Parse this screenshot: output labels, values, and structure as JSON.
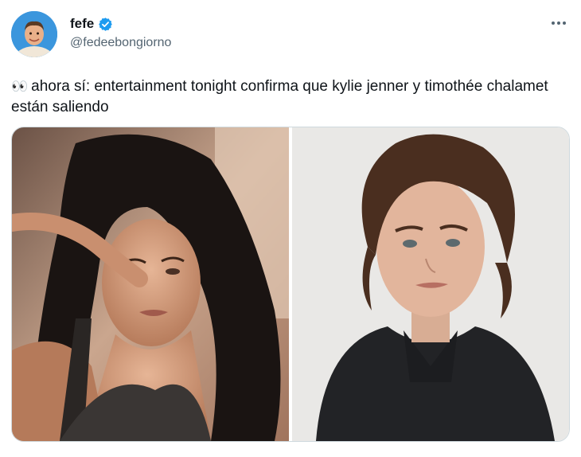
{
  "tweet": {
    "display_name": "fefe",
    "handle": "@fedeebongiorno",
    "verified": true,
    "eyes_emoji": "👀",
    "text": "ahora sí: entertainment tonight confirma que kylie jenner y timothée chalamet están saliendo",
    "more_icon": "more-horizontal-icon"
  },
  "colors": {
    "verified_blue": "#1d9bf0",
    "text_primary": "#0f1419",
    "text_secondary": "#536471"
  }
}
